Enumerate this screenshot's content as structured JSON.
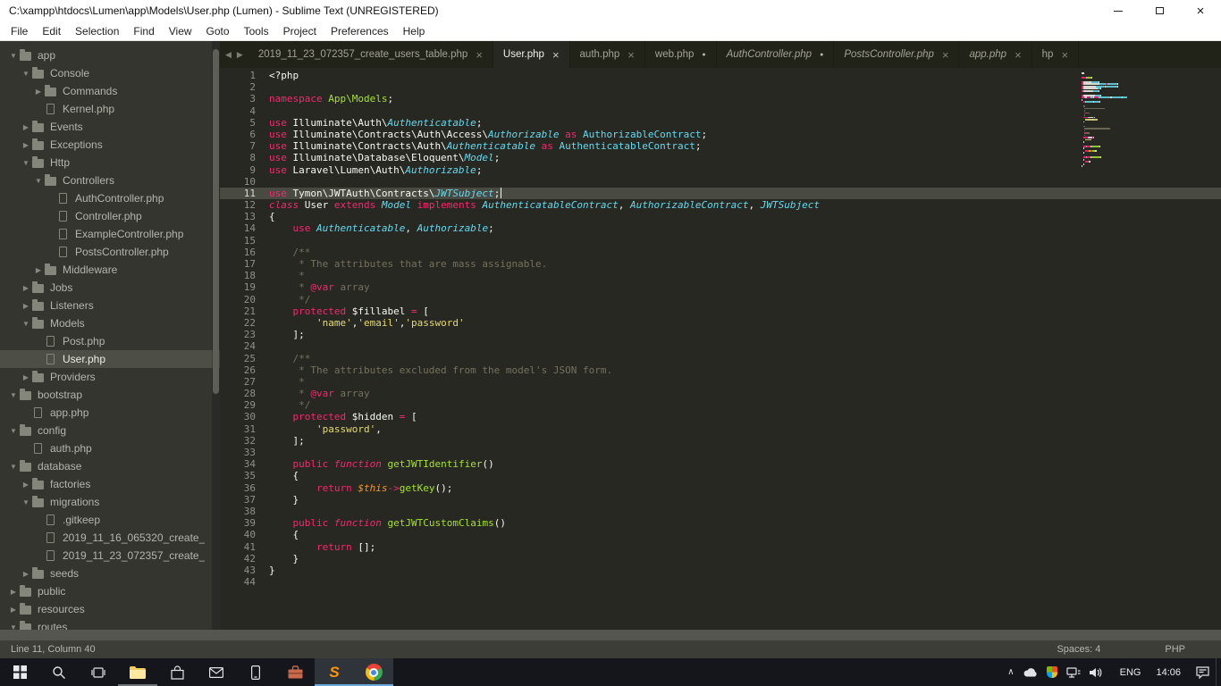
{
  "window": {
    "title": "C:\\xampp\\htdocs\\Lumen\\app\\Models\\User.php (Lumen) - Sublime Text (UNREGISTERED)",
    "controls": [
      "minimize",
      "restore",
      "close"
    ]
  },
  "menu": {
    "items": [
      "File",
      "Edit",
      "Selection",
      "Find",
      "View",
      "Goto",
      "Tools",
      "Project",
      "Preferences",
      "Help"
    ]
  },
  "tabs": [
    {
      "label": "2019_11_23_072357_create_users_table.php",
      "indicator": "close",
      "active": false,
      "preview": false
    },
    {
      "label": "User.php",
      "indicator": "close",
      "active": true,
      "preview": false
    },
    {
      "label": "auth.php",
      "indicator": "close",
      "active": false,
      "preview": false
    },
    {
      "label": "web.php",
      "indicator": "dot",
      "active": false,
      "preview": false
    },
    {
      "label": "AuthController.php",
      "indicator": "dot",
      "active": false,
      "preview": true
    },
    {
      "label": "PostsController.php",
      "indicator": "close",
      "active": false,
      "preview": true
    },
    {
      "label": "app.php",
      "indicator": "close",
      "active": false,
      "preview": true
    },
    {
      "label": "hp",
      "indicator": "close",
      "active": false,
      "preview": false
    }
  ],
  "sidebar": {
    "items": [
      {
        "label": "app",
        "type": "folder",
        "state": "open",
        "indent": 0
      },
      {
        "label": "Console",
        "type": "folder",
        "state": "open",
        "indent": 1
      },
      {
        "label": "Commands",
        "type": "folder",
        "state": "closed",
        "indent": 2
      },
      {
        "label": "Kernel.php",
        "type": "file",
        "indent": 2
      },
      {
        "label": "Events",
        "type": "folder",
        "state": "closed",
        "indent": 1
      },
      {
        "label": "Exceptions",
        "type": "folder",
        "state": "closed",
        "indent": 1
      },
      {
        "label": "Http",
        "type": "folder",
        "state": "open",
        "indent": 1
      },
      {
        "label": "Controllers",
        "type": "folder",
        "state": "open",
        "indent": 2
      },
      {
        "label": "AuthController.php",
        "type": "file",
        "indent": 3
      },
      {
        "label": "Controller.php",
        "type": "file",
        "indent": 3
      },
      {
        "label": "ExampleController.php",
        "type": "file",
        "indent": 3
      },
      {
        "label": "PostsController.php",
        "type": "file",
        "indent": 3
      },
      {
        "label": "Middleware",
        "type": "folder",
        "state": "closed",
        "indent": 2
      },
      {
        "label": "Jobs",
        "type": "folder",
        "state": "closed",
        "indent": 1
      },
      {
        "label": "Listeners",
        "type": "folder",
        "state": "closed",
        "indent": 1
      },
      {
        "label": "Models",
        "type": "folder",
        "state": "open",
        "indent": 1
      },
      {
        "label": "Post.php",
        "type": "file",
        "indent": 2
      },
      {
        "label": "User.php",
        "type": "file",
        "indent": 2,
        "selected": true
      },
      {
        "label": "Providers",
        "type": "folder",
        "state": "closed",
        "indent": 1
      },
      {
        "label": "bootstrap",
        "type": "folder",
        "state": "open",
        "indent": 0
      },
      {
        "label": "app.php",
        "type": "file",
        "indent": 1
      },
      {
        "label": "config",
        "type": "folder",
        "state": "open",
        "indent": 0
      },
      {
        "label": "auth.php",
        "type": "file",
        "indent": 1
      },
      {
        "label": "database",
        "type": "folder",
        "state": "open",
        "indent": 0
      },
      {
        "label": "factories",
        "type": "folder",
        "state": "closed",
        "indent": 1
      },
      {
        "label": "migrations",
        "type": "folder",
        "state": "open",
        "indent": 1
      },
      {
        "label": ".gitkeep",
        "type": "file",
        "indent": 2
      },
      {
        "label": "2019_11_16_065320_create_",
        "type": "file",
        "indent": 2
      },
      {
        "label": "2019_11_23_072357_create_",
        "type": "file",
        "indent": 2
      },
      {
        "label": "seeds",
        "type": "folder",
        "state": "closed",
        "indent": 1
      },
      {
        "label": "public",
        "type": "folder",
        "state": "closed",
        "indent": 0
      },
      {
        "label": "resources",
        "type": "folder",
        "state": "closed",
        "indent": 0
      },
      {
        "label": "routes",
        "type": "folder",
        "state": "open",
        "indent": 0
      }
    ]
  },
  "editor": {
    "active_line": 11,
    "lines": [
      [
        [
          "pl",
          "<?php"
        ]
      ],
      [],
      [
        [
          "kw",
          "namespace"
        ],
        [
          "pl",
          " "
        ],
        [
          "fn",
          "App\\Models"
        ],
        [
          "pl",
          ";"
        ]
      ],
      [],
      [
        [
          "kw",
          "use"
        ],
        [
          "pl",
          " Illuminate\\Auth\\"
        ],
        [
          "tyi",
          "Authenticatable"
        ],
        [
          "pl",
          ";"
        ]
      ],
      [
        [
          "kw",
          "use"
        ],
        [
          "pl",
          " Illuminate\\Contracts\\Auth\\Access\\"
        ],
        [
          "tyi",
          "Authorizable"
        ],
        [
          "pl",
          " "
        ],
        [
          "kw",
          "as"
        ],
        [
          "pl",
          " "
        ],
        [
          "ty",
          "AuthorizableContract"
        ],
        [
          "pl",
          ";"
        ]
      ],
      [
        [
          "kw",
          "use"
        ],
        [
          "pl",
          " Illuminate\\Contracts\\Auth\\"
        ],
        [
          "tyi",
          "Authenticatable"
        ],
        [
          "pl",
          " "
        ],
        [
          "kw",
          "as"
        ],
        [
          "pl",
          " "
        ],
        [
          "ty",
          "AuthenticatableContract"
        ],
        [
          "pl",
          ";"
        ]
      ],
      [
        [
          "kw",
          "use"
        ],
        [
          "pl",
          " Illuminate\\Database\\Eloquent\\"
        ],
        [
          "tyi",
          "Model"
        ],
        [
          "pl",
          ";"
        ]
      ],
      [
        [
          "kw",
          "use"
        ],
        [
          "pl",
          " Laravel\\Lumen\\Auth\\"
        ],
        [
          "tyi",
          "Authorizable"
        ],
        [
          "pl",
          ";"
        ]
      ],
      [],
      [
        [
          "kw",
          "use"
        ],
        [
          "pl",
          " Tymon\\JWTAuth\\Contracts\\"
        ],
        [
          "tyi",
          "JWTSubject"
        ],
        [
          "pl",
          ";"
        ]
      ],
      [
        [
          "kwi",
          "class"
        ],
        [
          "pl",
          " User "
        ],
        [
          "kw",
          "extends"
        ],
        [
          "pl",
          " "
        ],
        [
          "tyi",
          "Model"
        ],
        [
          "pl",
          " "
        ],
        [
          "kw",
          "implements"
        ],
        [
          "pl",
          " "
        ],
        [
          "tyi",
          "AuthenticatableContract"
        ],
        [
          "pl",
          ", "
        ],
        [
          "tyi",
          "AuthorizableContract"
        ],
        [
          "pl",
          ", "
        ],
        [
          "tyi",
          "JWTSubject"
        ]
      ],
      [
        [
          "pl",
          "{"
        ]
      ],
      [
        [
          "pl",
          "    "
        ],
        [
          "kw",
          "use"
        ],
        [
          "pl",
          " "
        ],
        [
          "tyi",
          "Authenticatable"
        ],
        [
          "pl",
          ", "
        ],
        [
          "tyi",
          "Authorizable"
        ],
        [
          "pl",
          ";"
        ]
      ],
      [],
      [
        [
          "cm",
          "    /**"
        ]
      ],
      [
        [
          "cm",
          "     * The attributes that are mass assignable."
        ]
      ],
      [
        [
          "cm",
          "     *"
        ]
      ],
      [
        [
          "cm",
          "     * "
        ],
        [
          "kw",
          "@var"
        ],
        [
          "cm",
          " array"
        ]
      ],
      [
        [
          "cm",
          "     */"
        ]
      ],
      [
        [
          "pl",
          "    "
        ],
        [
          "kw",
          "protected"
        ],
        [
          "pl",
          " $fillabel "
        ],
        [
          "kw",
          "="
        ],
        [
          "pl",
          " ["
        ]
      ],
      [
        [
          "pl",
          "        "
        ],
        [
          "st",
          "'name'"
        ],
        [
          "pl",
          ","
        ],
        [
          "st",
          "'email'"
        ],
        [
          "pl",
          ","
        ],
        [
          "st",
          "'password'"
        ]
      ],
      [
        [
          "pl",
          "    ];"
        ]
      ],
      [],
      [
        [
          "cm",
          "    /**"
        ]
      ],
      [
        [
          "cm",
          "     * The attributes excluded from the model's JSON form."
        ]
      ],
      [
        [
          "cm",
          "     *"
        ]
      ],
      [
        [
          "cm",
          "     * "
        ],
        [
          "kw",
          "@var"
        ],
        [
          "cm",
          " array"
        ]
      ],
      [
        [
          "cm",
          "     */"
        ]
      ],
      [
        [
          "pl",
          "    "
        ],
        [
          "kw",
          "protected"
        ],
        [
          "pl",
          " $hidden "
        ],
        [
          "kw",
          "="
        ],
        [
          "pl",
          " ["
        ]
      ],
      [
        [
          "pl",
          "        "
        ],
        [
          "st",
          "'password'"
        ],
        [
          "pl",
          ","
        ]
      ],
      [
        [
          "pl",
          "    ];"
        ]
      ],
      [],
      [
        [
          "pl",
          "    "
        ],
        [
          "kw",
          "public"
        ],
        [
          "pl",
          " "
        ],
        [
          "kwi",
          "function"
        ],
        [
          "pl",
          " "
        ],
        [
          "fn",
          "getJWTIdentifier"
        ],
        [
          "pl",
          "()"
        ]
      ],
      [
        [
          "pl",
          "    {"
        ]
      ],
      [
        [
          "pl",
          "        "
        ],
        [
          "kw",
          "return"
        ],
        [
          "pl",
          " "
        ],
        [
          "th",
          "$this"
        ],
        [
          "kw",
          "->"
        ],
        [
          "fn",
          "getKey"
        ],
        [
          "pl",
          "();"
        ]
      ],
      [
        [
          "pl",
          "    }"
        ]
      ],
      [],
      [
        [
          "pl",
          "    "
        ],
        [
          "kw",
          "public"
        ],
        [
          "pl",
          " "
        ],
        [
          "kwi",
          "function"
        ],
        [
          "pl",
          " "
        ],
        [
          "fn",
          "getJWTCustomClaims"
        ],
        [
          "pl",
          "()"
        ]
      ],
      [
        [
          "pl",
          "    {"
        ]
      ],
      [
        [
          "pl",
          "        "
        ],
        [
          "kw",
          "return"
        ],
        [
          "pl",
          " [];"
        ]
      ],
      [
        [
          "pl",
          "    }"
        ]
      ],
      [
        [
          "pl",
          "}"
        ]
      ],
      []
    ]
  },
  "status": {
    "position": "Line 11, Column 40",
    "indent": "Spaces: 4",
    "syntax": "PHP"
  },
  "taskbar": {
    "left_icons": [
      "start",
      "search",
      "task-view",
      "file-explorer",
      "store",
      "mail",
      "phone",
      "toolbox",
      "sublime-text",
      "chrome"
    ],
    "active_apps": [
      "sublime-text",
      "chrome"
    ],
    "open_apps": [
      "file-explorer"
    ],
    "tray_icons": [
      "hidden-icons",
      "cloud",
      "security-shield",
      "network",
      "volume"
    ],
    "language": "ENG",
    "time": "14:06"
  },
  "colors": {
    "editor_bg": "#272822",
    "sidebar_bg": "#34352f",
    "tabbar_bg": "#222318",
    "active_line_bg": "#494a42",
    "selected_item_bg": "#4d4e46",
    "statusbar_bg": "#3c3d37",
    "titlebar_bg": "#ffffff",
    "taskbar_bg": "#15161b",
    "gutter": "#8f908a",
    "tokens": {
      "pl": "#f8f8f2",
      "kw": "#f92672",
      "kwi": "#f92672",
      "ty": "#66d9ef",
      "tyi": "#66d9ef",
      "fn": "#a6e22e",
      "st": "#e6db74",
      "cm": "#75715e",
      "th": "#fd971f"
    }
  }
}
